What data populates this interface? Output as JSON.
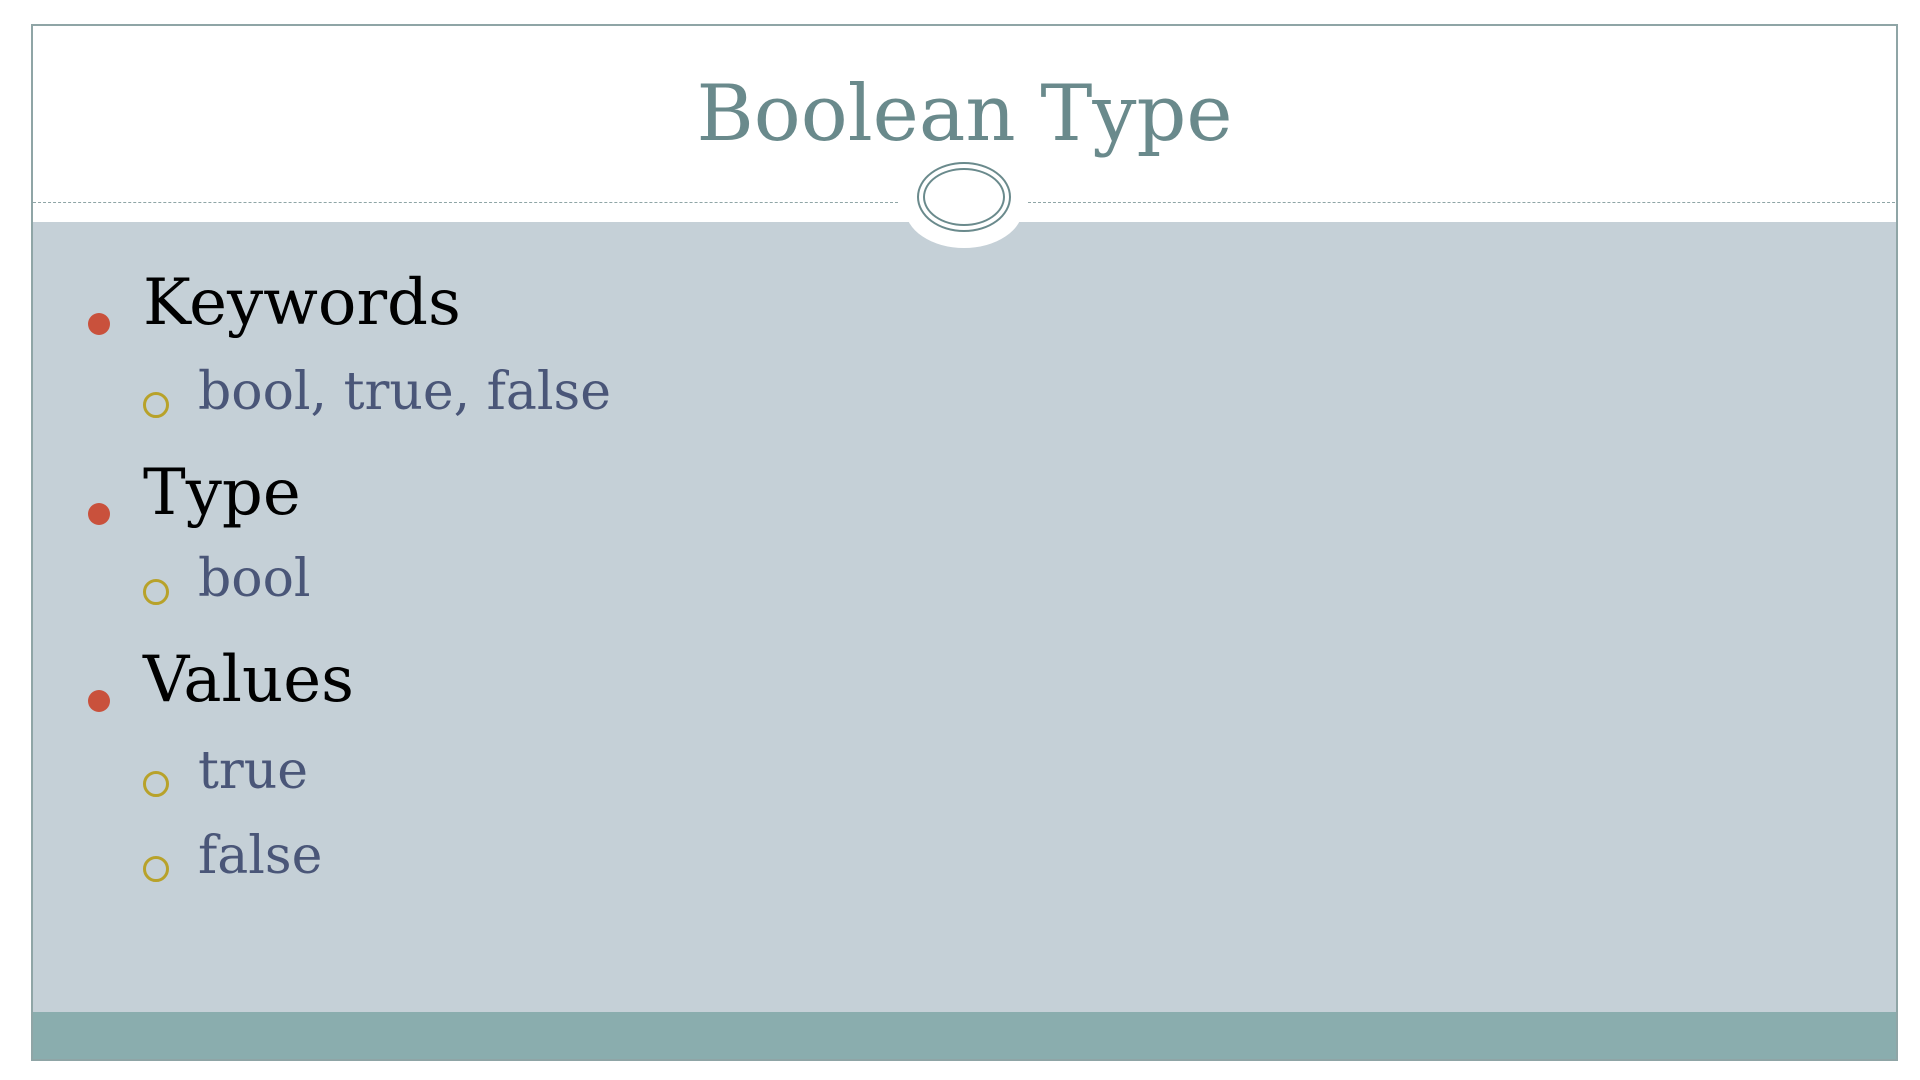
{
  "slide": {
    "title": "Boolean Type",
    "items": [
      {
        "label": "Keywords",
        "children": [
          "bool, true, false"
        ]
      },
      {
        "label": "Type",
        "children": [
          "bool"
        ]
      },
      {
        "label": "Values",
        "children": [
          "true",
          "false"
        ]
      }
    ]
  },
  "colors": {
    "title": "#6a8a8c",
    "content_background": "#c5d0d7",
    "footer_band": "#8aadae",
    "level1_bullet": "#c9513c",
    "level2_bullet": "#b8a22a",
    "level2_text": "#4a5678"
  }
}
